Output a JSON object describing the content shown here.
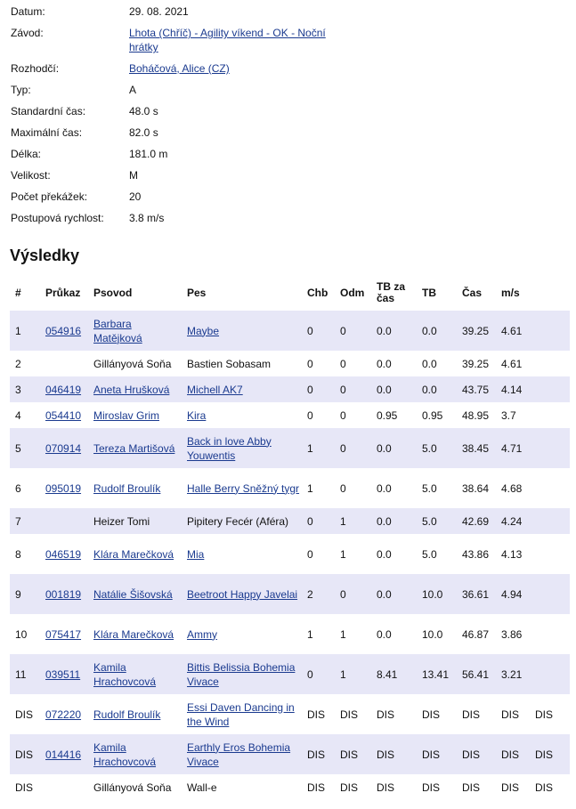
{
  "info": [
    {
      "label": "Datum:",
      "value": "29. 08. 2021",
      "link": false
    },
    {
      "label": "Závod:",
      "value": "Lhota (Chříč) - Agility víkend - OK - Noční hrátky",
      "link": true
    },
    {
      "label": "Rozhodčí:",
      "value": "Boháčová, Alice (CZ)",
      "link": true
    },
    {
      "label": "Typ:",
      "value": "A",
      "link": false
    },
    {
      "label": "Standardní čas:",
      "value": "48.0 s",
      "link": false
    },
    {
      "label": "Maximální čas:",
      "value": "82.0 s",
      "link": false
    },
    {
      "label": "Délka:",
      "value": "181.0 m",
      "link": false
    },
    {
      "label": "Velikost:",
      "value": "M",
      "link": false
    },
    {
      "label": "Počet překážek:",
      "value": "20",
      "link": false
    },
    {
      "label": "Postupová rychlost:",
      "value": "3.8 m/s",
      "link": false
    }
  ],
  "results_title": "Výsledky",
  "columns": [
    "#",
    "Průkaz",
    "Psovod",
    "Pes",
    "Chb",
    "Odm",
    "TB za čas",
    "TB",
    "Čas",
    "m/s",
    ""
  ],
  "rows": [
    {
      "rank": "1",
      "prukaz": "054916",
      "psovod": "Barbara Matějková",
      "pes": "Maybe",
      "chb": "0",
      "odm": "0",
      "tbcas": "0.0",
      "tb": "0.0",
      "cas": "39.25",
      "ms": "4.61",
      "extra": ""
    },
    {
      "rank": "2",
      "prukaz": "",
      "psovod": "Gillányová Soňa",
      "pes": "Bastien Sobasam",
      "chb": "0",
      "odm": "0",
      "tbcas": "0.0",
      "tb": "0.0",
      "cas": "39.25",
      "ms": "4.61",
      "extra": ""
    },
    {
      "rank": "3",
      "prukaz": "046419",
      "psovod": "Aneta Hrušková",
      "pes": "Michell AK7",
      "chb": "0",
      "odm": "0",
      "tbcas": "0.0",
      "tb": "0.0",
      "cas": "43.75",
      "ms": "4.14",
      "extra": ""
    },
    {
      "rank": "4",
      "prukaz": "054410",
      "psovod": "Miroslav Grim",
      "pes": "Kira",
      "chb": "0",
      "odm": "0",
      "tbcas": "0.95",
      "tb": "0.95",
      "cas": "48.95",
      "ms": "3.7",
      "extra": ""
    },
    {
      "rank": "5",
      "prukaz": "070914",
      "psovod": "Tereza Martišová",
      "pes": "Back in love Abby Youwentis",
      "chb": "1",
      "odm": "0",
      "tbcas": "0.0",
      "tb": "5.0",
      "cas": "38.45",
      "ms": "4.71",
      "extra": ""
    },
    {
      "rank": "6",
      "prukaz": "095019",
      "psovod": "Rudolf Broulík",
      "pes": "Halle Berry Sněžný tygr",
      "chb": "1",
      "odm": "0",
      "tbcas": "0.0",
      "tb": "5.0",
      "cas": "38.64",
      "ms": "4.68",
      "extra": ""
    },
    {
      "rank": "7",
      "prukaz": "",
      "psovod": "Heizer Tomi",
      "pes": "Pipitery Fecér (Aféra)",
      "chb": "0",
      "odm": "1",
      "tbcas": "0.0",
      "tb": "5.0",
      "cas": "42.69",
      "ms": "4.24",
      "extra": ""
    },
    {
      "rank": "8",
      "prukaz": "046519",
      "psovod": "Klára Marečková",
      "pes": "Mia",
      "chb": "0",
      "odm": "1",
      "tbcas": "0.0",
      "tb": "5.0",
      "cas": "43.86",
      "ms": "4.13",
      "extra": ""
    },
    {
      "rank": "9",
      "prukaz": "001819",
      "psovod": "Natálie Šišovská",
      "pes": "Beetroot Happy Javelai",
      "chb": "2",
      "odm": "0",
      "tbcas": "0.0",
      "tb": "10.0",
      "cas": "36.61",
      "ms": "4.94",
      "extra": ""
    },
    {
      "rank": "10",
      "prukaz": "075417",
      "psovod": "Klára Marečková",
      "pes": "Ammy",
      "chb": "1",
      "odm": "1",
      "tbcas": "0.0",
      "tb": "10.0",
      "cas": "46.87",
      "ms": "3.86",
      "extra": ""
    },
    {
      "rank": "11",
      "prukaz": "039511",
      "psovod": "Kamila Hrachovcová",
      "pes": "Bittis Belissia Bohemia Vivace",
      "chb": "0",
      "odm": "1",
      "tbcas": "8.41",
      "tb": "13.41",
      "cas": "56.41",
      "ms": "3.21",
      "extra": ""
    },
    {
      "rank": "DIS",
      "prukaz": "072220",
      "psovod": "Rudolf Broulík",
      "pes": "Essi Daven Dancing in the Wind",
      "chb": "DIS",
      "odm": "DIS",
      "tbcas": "DIS",
      "tb": "DIS",
      "cas": "DIS",
      "ms": "DIS",
      "extra": "DIS"
    },
    {
      "rank": "DIS",
      "prukaz": "014416",
      "psovod": "Kamila Hrachovcová",
      "pes": "Earthly Eros Bohemia Vivace",
      "chb": "DIS",
      "odm": "DIS",
      "tbcas": "DIS",
      "tb": "DIS",
      "cas": "DIS",
      "ms": "DIS",
      "extra": "DIS"
    },
    {
      "rank": "DIS",
      "prukaz": "",
      "psovod": "Gillányová Soňa",
      "pes": "Wall-e",
      "chb": "DIS",
      "odm": "DIS",
      "tbcas": "DIS",
      "tb": "DIS",
      "cas": "DIS",
      "ms": "DIS",
      "extra": "DIS"
    }
  ]
}
